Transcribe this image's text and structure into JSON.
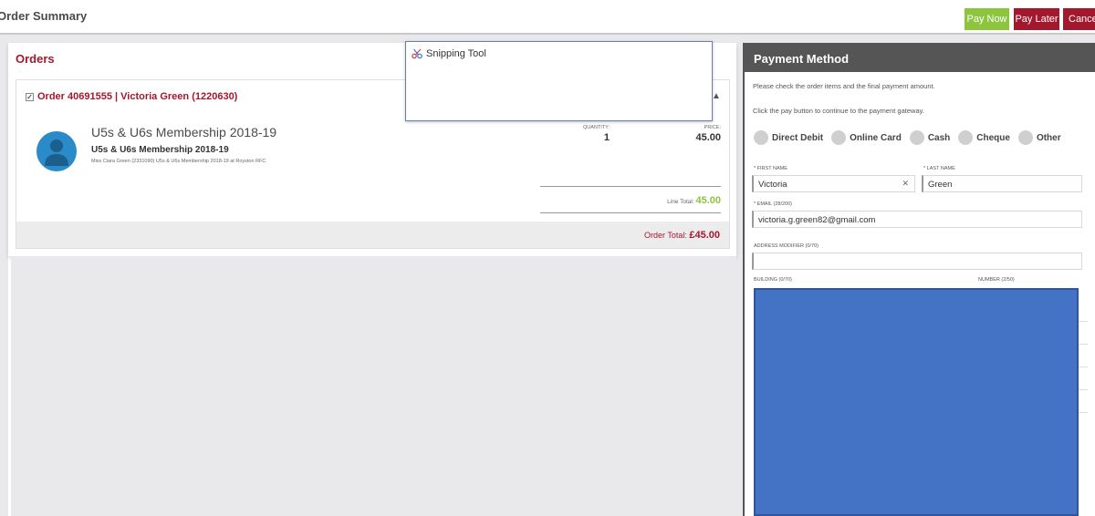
{
  "topbar": {
    "title": "Order Summary",
    "pay_now": "Pay Now",
    "pay_later": "Pay Later",
    "cancel": "Cancel"
  },
  "orders": {
    "title": "Orders",
    "order_header": "Order 40691555 | Victoria Green (1220630)",
    "item": {
      "title": "U5s & U6s Membership 2018-19",
      "subtitle": "U5s & U6s Membership 2018-19",
      "description": "Miss Ciara Green (2331090) U5s & U6s Membership 2018-19 at Royston RFC",
      "quantity_label": "QUANTITY:",
      "quantity": "1",
      "price_label": "PRICE:",
      "price": "45.00"
    },
    "line_total_label": "Line Total: ",
    "line_total": "45.00",
    "order_total_label": "Order Total: ",
    "order_total": "£45.00"
  },
  "payment": {
    "title": "Payment Method",
    "line1": "Please check the order items and the final payment amount.",
    "line2": "Click the pay button to continue to the payment gateway.",
    "methods": [
      "Direct Debit",
      "Online Card",
      "Cash",
      "Cheque",
      "Other"
    ],
    "first_name_label": "* FIRST NAME",
    "first_name": "Victoria",
    "last_name_label": "* LAST NAME",
    "last_name": "Green",
    "email_label": "* EMAIL (28/200)",
    "email": "victoria.g.green82@gmail.com",
    "address_modifier_label": "ADDRESS MODIFIER (0/70)",
    "building_label": "BUILDING (0/70)",
    "number_label": "NUMBER (2/50)"
  },
  "snipping_tool": {
    "title": "Snipping Tool"
  },
  "colors": {
    "accent_red": "#a4182d",
    "accent_green": "#8dc53f",
    "header_gray": "#555555",
    "overlay_blue": "#4472c4"
  }
}
